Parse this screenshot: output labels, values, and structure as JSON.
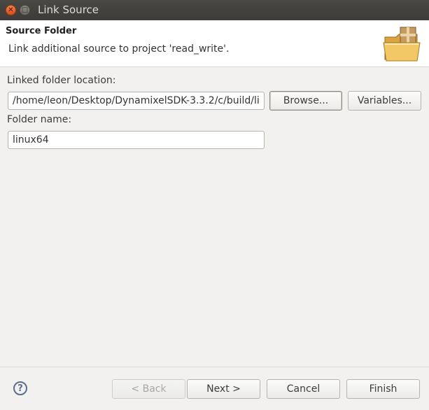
{
  "window": {
    "title": "Link Source"
  },
  "header": {
    "title": "Source Folder",
    "description": "Link additional source to project 'read_write'."
  },
  "form": {
    "location_label": "Linked folder location:",
    "location_value": "/home/leon/Desktop/DynamixelSDK-3.3.2/c/build/li",
    "browse_label": "Browse...",
    "variables_label": "Variables...",
    "folder_label": "Folder name:",
    "folder_value": "linux64"
  },
  "footer": {
    "help_glyph": "?",
    "back_label": "< Back",
    "next_label": "Next >",
    "cancel_label": "Cancel",
    "finish_label": "Finish"
  },
  "colors": {
    "titlebar": "#3c3b37",
    "close_button": "#df4a16",
    "background": "#f2f1f0"
  }
}
